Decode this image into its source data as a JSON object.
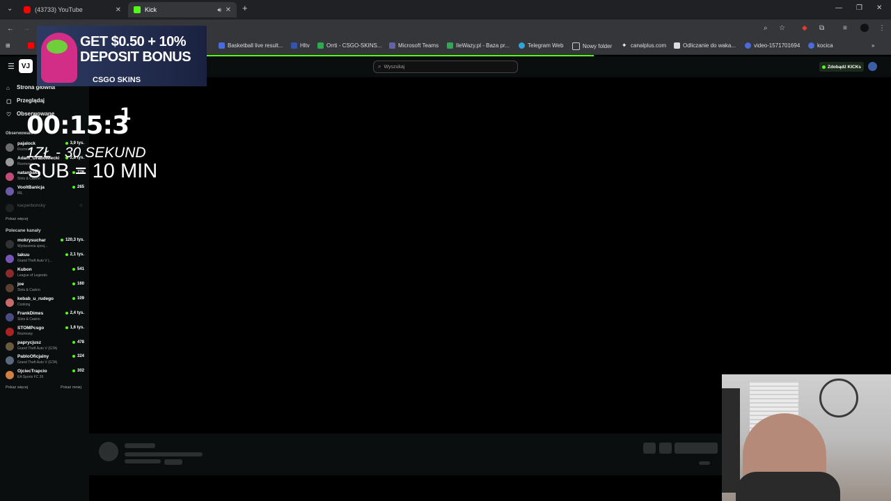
{
  "tabs": [
    {
      "label": "(43733) YouTube",
      "color": "#ff0000"
    },
    {
      "label": "Kick",
      "color": "#53fc18"
    }
  ],
  "bookmarks": [
    {
      "label": "Basketball live result...",
      "color": "#4a6bd8"
    },
    {
      "label": "Hltv",
      "color": "#3355aa"
    },
    {
      "label": "Orrti - CSGO-SKINS...",
      "color": "#2fa84f"
    },
    {
      "label": "Microsoft Teams",
      "color": "#6264a7"
    },
    {
      "label": "IleWazy.pl - Baza pr...",
      "color": "#3aa35a"
    },
    {
      "label": "Telegram Web",
      "color": "#2ea6dc"
    },
    {
      "label": "Nowy folder",
      "color": "#cccccc"
    },
    {
      "label": "canalplus.com",
      "color": "#ffffff"
    },
    {
      "label": "Odliczanie do waka...",
      "color": "#dddddd"
    },
    {
      "label": "video-1571701694",
      "color": "#4a6bd8"
    },
    {
      "label": "kocica",
      "color": "#4a6bd8"
    }
  ],
  "header": {
    "search_placeholder": "Wyszukaj",
    "kicks_button": "Zdobądź KICKs"
  },
  "nav": {
    "home": "Strona główna",
    "browse": "Przeglądaj",
    "following": "Obserwowane"
  },
  "followed_header": "Obserwowani",
  "followed": [
    {
      "name": "pajalock",
      "category": "Rozmowy",
      "viewers": "3,9 tys.",
      "color": "#6b6b6b"
    },
    {
      "name": "Adam_Grabowiecki",
      "category": "Rozmowy",
      "viewers": "2,8 tys.",
      "color": "#9a9a9a"
    },
    {
      "name": "natanbaku",
      "category": "Slots & Casino",
      "viewers": "776",
      "color": "#c04b7a"
    },
    {
      "name": "VooltBanicja",
      "category": "IRL",
      "viewers": "265",
      "color": "#6a5aa8"
    },
    {
      "name": "kacperbonsky",
      "category": "",
      "viewers": "",
      "color": "#444444"
    }
  ],
  "show_more": "Pokaż więcej",
  "recommended_header": "Polecane kanały",
  "recommended": [
    {
      "name": "mokrysuchar",
      "category": "Wydarzenia specj...",
      "viewers": "120,3 tys.",
      "color": "#333333"
    },
    {
      "name": "takuu",
      "category": "Grand Theft Auto V (...",
      "viewers": "2,1 tys.",
      "color": "#7a55b8"
    },
    {
      "name": "Kubon",
      "category": "League of Legends",
      "viewers": "541",
      "color": "#8a2a2a"
    },
    {
      "name": "joe",
      "category": "Slots & Casino",
      "viewers": "160",
      "color": "#5a4030"
    },
    {
      "name": "kebab_u_rudego",
      "category": "Cooking",
      "viewers": "109",
      "color": "#c66a6a"
    },
    {
      "name": "FrankDimes",
      "category": "Slots & Casino",
      "viewers": "2,4 tys.",
      "color": "#4a4a80"
    },
    {
      "name": "STOMPcsgo",
      "category": "Rozmowy",
      "viewers": "1,6 tys.",
      "color": "#aa2222"
    },
    {
      "name": "paprycjusz",
      "category": "Grand Theft Auto V (GTA)",
      "viewers": "478",
      "color": "#6a5a40"
    },
    {
      "name": "PabloOficjalny",
      "category": "Grand Theft Auto V (GTA)",
      "viewers": "324",
      "color": "#5a6a7a"
    },
    {
      "name": "OjciecTrapcio",
      "category": "EA Sports FC 26",
      "viewers": "302",
      "color": "#d08040"
    }
  ],
  "show_less": "Pokaż mniej",
  "overlay": {
    "ad_line1": "GET $0.50 + 10%",
    "ad_line2": "DEPOSIT BONUS",
    "ad_brand": "CSGO SKINS",
    "timer": "00:15:3",
    "timer_digit": "1",
    "rule1": "1ZŁ - 30 SEKUND",
    "rule2": "SUB = 10 MIN"
  }
}
